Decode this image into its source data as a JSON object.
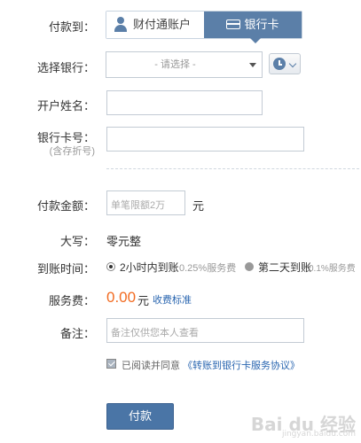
{
  "pay_to": {
    "label": "付款到：",
    "tabs": [
      {
        "label": "财付通账户",
        "active": false
      },
      {
        "label": "银行卡",
        "active": true
      }
    ]
  },
  "bank": {
    "label": "选择银行：",
    "placeholder": "- 请选择 -"
  },
  "name": {
    "label": "开户姓名：",
    "value": ""
  },
  "card": {
    "label": "银行卡号：",
    "sublabel": "(含存折号)",
    "value": ""
  },
  "amount": {
    "label": "付款金额：",
    "placeholder": "单笔限额2万",
    "unit": "元"
  },
  "upper": {
    "label": "大写：",
    "value": "零元整"
  },
  "arrival": {
    "label": "到账时间：",
    "options": [
      {
        "label": "2小时内到账",
        "fee": "0.25%服务费",
        "selected": true
      },
      {
        "label": "第二天到账",
        "fee": "0.1%服务费",
        "selected": false
      }
    ]
  },
  "fee": {
    "label": "服务费：",
    "amount": "0.00",
    "unit": "元",
    "link": "收费标准"
  },
  "memo": {
    "label": "备注：",
    "placeholder": "备注仅供您本人查看"
  },
  "agreement": {
    "checked": true,
    "text": "已阅读并同意",
    "link": "《转账到银行卡服务协议》"
  },
  "submit": {
    "label": "付款"
  },
  "watermark": {
    "text": "Bai du 经验",
    "sub": "jingyan.baidu.com"
  },
  "colors": {
    "accent": "#5b7fa8",
    "button": "#4a75a6",
    "fee": "#f26b21",
    "link": "#2a66b0"
  }
}
